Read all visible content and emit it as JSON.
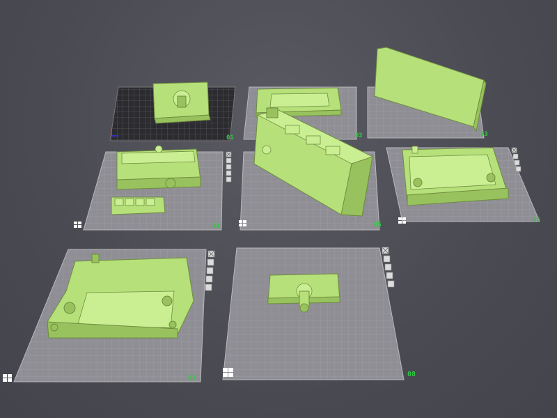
{
  "plates": [
    {
      "id": "plate-01",
      "label": "01"
    },
    {
      "id": "plate-02",
      "label": "02"
    },
    {
      "id": "plate-03",
      "label": "03"
    },
    {
      "id": "plate-04",
      "label": "04"
    },
    {
      "id": "plate-05",
      "label": "05"
    },
    {
      "id": "plate-06",
      "label": "06"
    },
    {
      "id": "plate-07",
      "label": "07"
    },
    {
      "id": "plate-08",
      "label": "08"
    }
  ],
  "plate_tools": [
    "close-icon",
    "lock-icon",
    "arrange-icon",
    "settings-icon",
    "orient-icon"
  ],
  "colors": {
    "background": "#4a4a52",
    "plate": "#8e8e94",
    "active_plate": "#2a2a2e",
    "model": "#b6e07a",
    "plate_label": "#2ecc40"
  }
}
